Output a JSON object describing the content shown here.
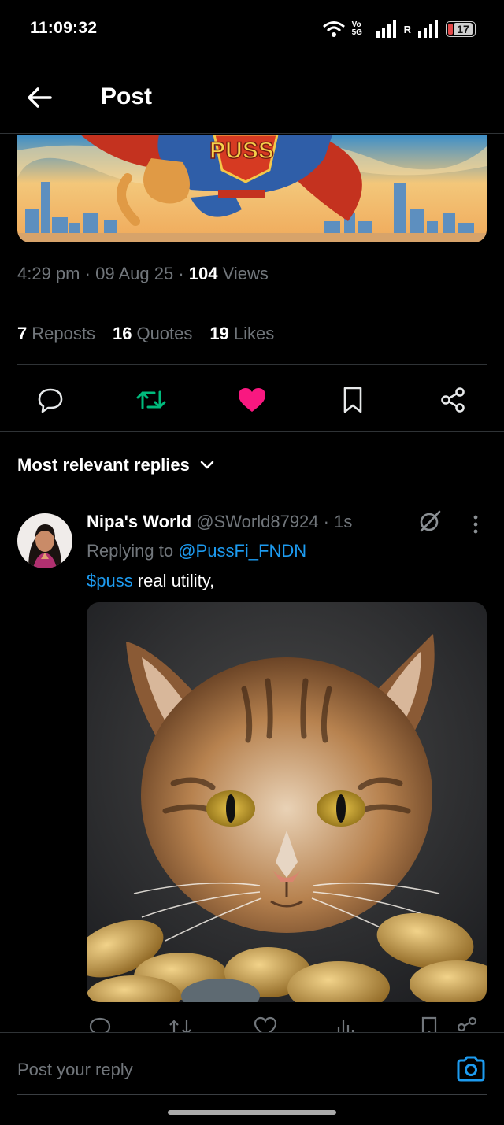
{
  "status_bar": {
    "time": "11:09:32",
    "network_label": "Vo 5G",
    "roaming": "R",
    "battery": "17"
  },
  "header": {
    "title": "Post"
  },
  "post": {
    "banner_text": "PUSS",
    "time": "4:29 pm",
    "date": "09 Aug 25",
    "views_count": "104",
    "views_label": "Views",
    "reposts_count": "7",
    "reposts_label": "Reposts",
    "quotes_count": "16",
    "quotes_label": "Quotes",
    "likes_count": "19",
    "likes_label": "Likes"
  },
  "actions": [
    {
      "name": "reply",
      "icon": "reply-icon"
    },
    {
      "name": "repost",
      "icon": "repost-icon",
      "active_color": "#00ba7c"
    },
    {
      "name": "like",
      "icon": "heart-icon",
      "active_color": "#f91880"
    },
    {
      "name": "bookmark",
      "icon": "bookmark-icon"
    },
    {
      "name": "share",
      "icon": "share-icon"
    }
  ],
  "replies": {
    "sort_label": "Most relevant replies",
    "items": [
      {
        "display_name": "Nipa's World",
        "handle": "@SWorld87924",
        "time": "1s",
        "replying_prefix": "Replying to",
        "replying_to": "@PussFi_FNDN",
        "cashtag": "$puss",
        "text": " real utility,"
      }
    ]
  },
  "compose": {
    "placeholder": "Post your reply"
  },
  "colors": {
    "accent": "#1d9bf0",
    "like": "#f91880",
    "repost": "#00ba7c",
    "muted": "#71767b"
  }
}
